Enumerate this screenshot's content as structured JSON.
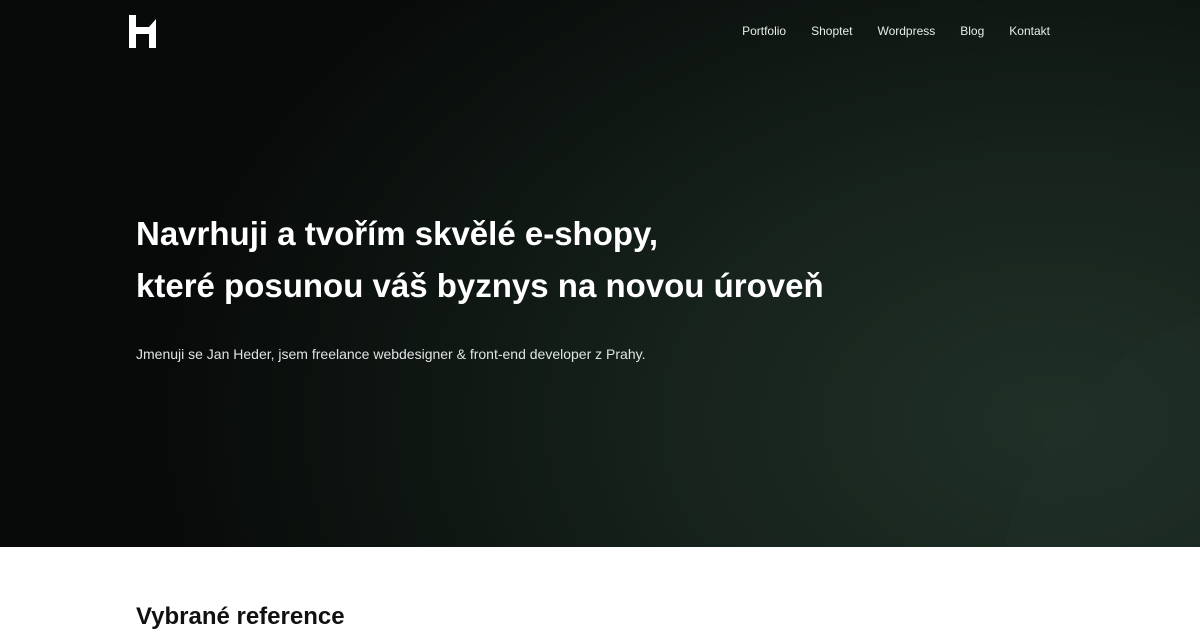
{
  "brand": {
    "logo_icon": "h-monogram-logo",
    "logo_color": "#ffffff"
  },
  "nav": {
    "items": [
      {
        "label": "Portfolio"
      },
      {
        "label": "Shoptet"
      },
      {
        "label": "Wordpress"
      },
      {
        "label": "Blog"
      },
      {
        "label": "Kontakt"
      }
    ]
  },
  "hero": {
    "headline_line1": "Navrhuji a tvořím skvělé e-shopy,",
    "headline_line2": "které posunou váš byznys na novou úroveň",
    "intro": "Jmenuji se Jan Heder, jsem freelance webdesigner & front-end developer z Prahy.",
    "background_color": "#0c120f",
    "accent_color": "#1f3027"
  },
  "references": {
    "title": "Vybrané reference"
  }
}
